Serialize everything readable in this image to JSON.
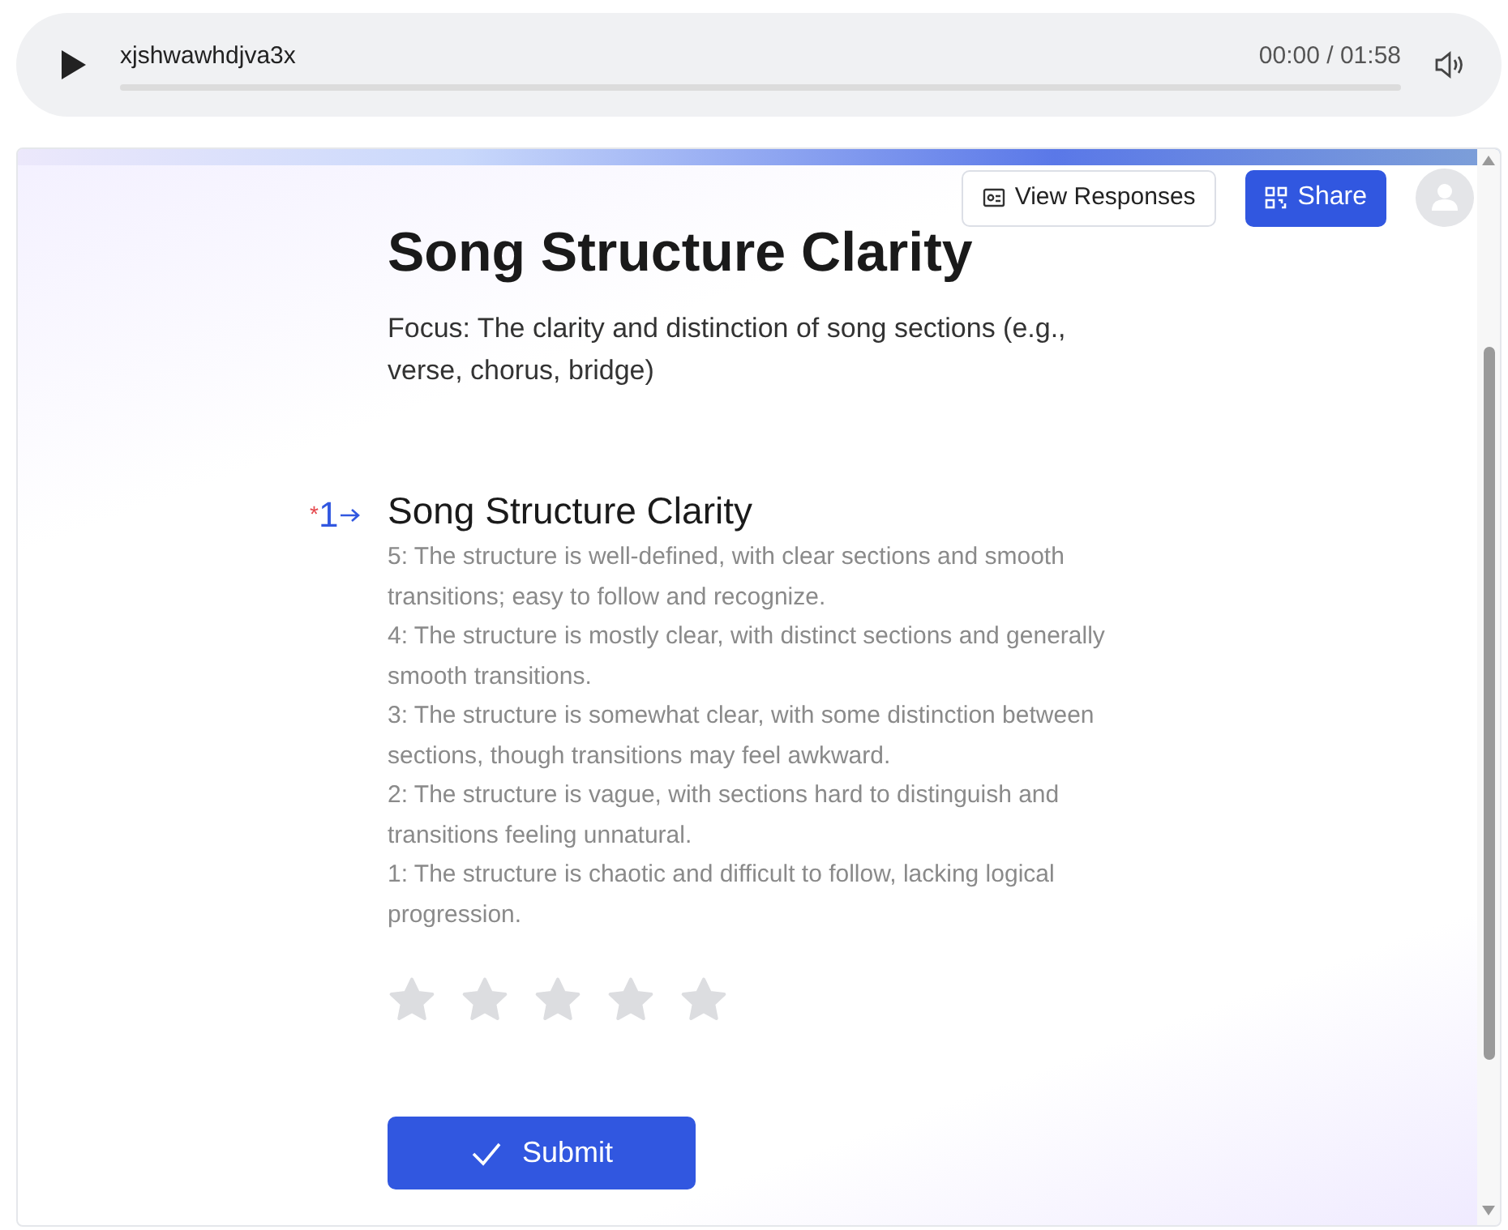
{
  "player": {
    "track": "xjshwawhdjva3x",
    "time": "00:00 / 01:58",
    "level": 0
  },
  "toolbar": {
    "view_responses": "View Responses",
    "share": "Share"
  },
  "form": {
    "title": "Song Structure Clarity",
    "description": "Focus: The clarity and distinction of song sections (e.g., verse, chorus, bridge)"
  },
  "question": {
    "required_mark": "*",
    "number": "1",
    "title": "Song Structure Clarity",
    "criteria": [
      "5: The structure is well-defined, with clear sections and smooth transitions; easy to follow and recognize.",
      "4: The structure is mostly clear, with distinct sections and generally smooth transitions.",
      "3: The structure is somewhat clear, with some distinction between sections, though transitions may feel awkward.",
      "2: The structure is vague, with sections hard to distinguish and transitions feeling unnatural.",
      "1: The structure is chaotic and difficult to follow, lacking logical progression."
    ],
    "stars": 0
  },
  "submit": "Submit"
}
